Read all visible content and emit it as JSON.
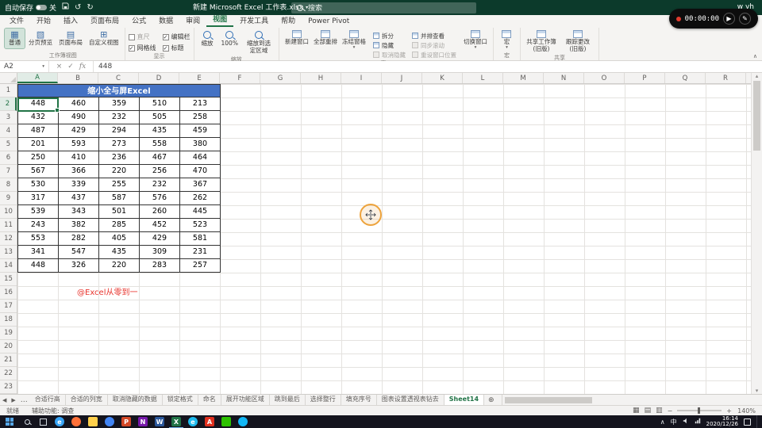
{
  "titlebar": {
    "autosave": "自动保存",
    "autosave_state": "关",
    "title": "新建 Microsoft Excel 工作表.xlsx",
    "search": "搜索",
    "user": "w yh"
  },
  "recorder": {
    "time": "00:00:00"
  },
  "ribbon": {
    "tabs": [
      "文件",
      "开始",
      "插入",
      "页面布局",
      "公式",
      "数据",
      "审阅",
      "视图",
      "开发工具",
      "帮助",
      "Power Pivot"
    ],
    "active_tab": "视图",
    "workbook_views": {
      "label": "工作簿视图",
      "buttons": [
        "普通",
        "分页预览",
        "页面布局",
        "自定义视图"
      ],
      "active": "普通"
    },
    "show": {
      "label": "显示",
      "checkboxes": [
        {
          "label": "直尺",
          "checked": false
        },
        {
          "label": "编辑栏",
          "checked": true
        },
        {
          "label": "网格线",
          "checked": true
        },
        {
          "label": "标题",
          "checked": true
        }
      ]
    },
    "zoom": {
      "label": "缩放",
      "buttons": [
        "缩放",
        "100%",
        "缩放到选定区域"
      ]
    },
    "window": {
      "label": "窗口",
      "large_buttons": [
        "新建窗口",
        "全部重排",
        "冻结窗格"
      ],
      "small_buttons": [
        "拆分",
        "隐藏",
        "取消隐藏",
        "并排查看",
        "同步滚动",
        "重设窗口位置"
      ],
      "disabled_small": [
        "取消隐藏",
        "同步滚动",
        "重设窗口位置"
      ],
      "switch_button": "切换窗口"
    },
    "macros": {
      "label": "宏",
      "buttons": [
        "宏"
      ]
    },
    "share": {
      "label": "共享",
      "buttons": [
        "共享工作簿(旧版)",
        "跟踪更改(旧版)"
      ]
    }
  },
  "formula_bar": {
    "name_box": "A2",
    "fx": "fx",
    "value": "448"
  },
  "grid": {
    "columns": [
      "A",
      "B",
      "C",
      "D",
      "E",
      "F",
      "G",
      "H",
      "I",
      "J",
      "K",
      "L",
      "M",
      "N",
      "O",
      "P",
      "Q",
      "R"
    ],
    "row_count": 23,
    "selected_cell": "A2",
    "selected_col": "A",
    "selected_row": "2",
    "title_cell": {
      "text": "缩小全与屏Excel",
      "range": "A1:E1",
      "bg": "#4472c4",
      "color": "#ffffff"
    },
    "table_rows": [
      [
        448,
        460,
        359,
        510,
        213
      ],
      [
        432,
        490,
        232,
        505,
        258
      ],
      [
        487,
        429,
        294,
        435,
        459
      ],
      [
        201,
        593,
        273,
        558,
        380
      ],
      [
        250,
        410,
        236,
        467,
        464
      ],
      [
        567,
        366,
        220,
        256,
        470
      ],
      [
        530,
        339,
        255,
        232,
        367
      ],
      [
        317,
        437,
        587,
        576,
        262
      ],
      [
        539,
        343,
        501,
        260,
        445
      ],
      [
        243,
        382,
        285,
        452,
        523
      ],
      [
        553,
        282,
        405,
        429,
        581
      ],
      [
        341,
        547,
        435,
        309,
        231
      ],
      [
        448,
        326,
        220,
        283,
        257
      ]
    ],
    "annotation": {
      "text": "@Excel从零到一",
      "color": "#e8352e",
      "cell": "B16"
    }
  },
  "sheet_bar": {
    "overflow": "…",
    "tabs": [
      "合适行高",
      "合适的列宽",
      "取消隐藏的数据",
      "锁定格式",
      "命名",
      "展开功能区域",
      "跳到最后",
      "选择整行",
      "填充序号",
      "图表设置透视表钻去",
      "Sheet14"
    ],
    "active": "Sheet14"
  },
  "status_bar": {
    "ready": "就绪",
    "accessibility": "辅助功能: 调查",
    "zoom": "140%"
  },
  "taskbar": {
    "ime": "中",
    "time": "16:14",
    "date": "2020/12/26",
    "apps": [
      {
        "name": "edge",
        "color": "#36a3f5",
        "glyph": "e",
        "shape": "circle"
      },
      {
        "name": "firefox",
        "color": "#ff7139",
        "glyph": "",
        "shape": "circle"
      },
      {
        "name": "file-explorer",
        "color": "#ffd04c",
        "glyph": ""
      },
      {
        "name": "chrome",
        "color": "#4285f4",
        "glyph": "",
        "shape": "circle"
      },
      {
        "name": "powerpoint",
        "color": "#d24726",
        "glyph": "P"
      },
      {
        "name": "onenote",
        "color": "#7719aa",
        "glyph": "N"
      },
      {
        "name": "word",
        "color": "#2b579a",
        "glyph": "W"
      },
      {
        "name": "excel",
        "color": "#217346",
        "glyph": "X",
        "active": true
      },
      {
        "name": "ie",
        "color": "#1ebbee",
        "glyph": "e",
        "shape": "circle"
      },
      {
        "name": "acrobat",
        "color": "#e0301e",
        "glyph": "A"
      },
      {
        "name": "wechat",
        "color": "#2dc100",
        "glyph": ""
      },
      {
        "name": "qq",
        "color": "#12b7f5",
        "glyph": "",
        "shape": "circle"
      }
    ]
  }
}
